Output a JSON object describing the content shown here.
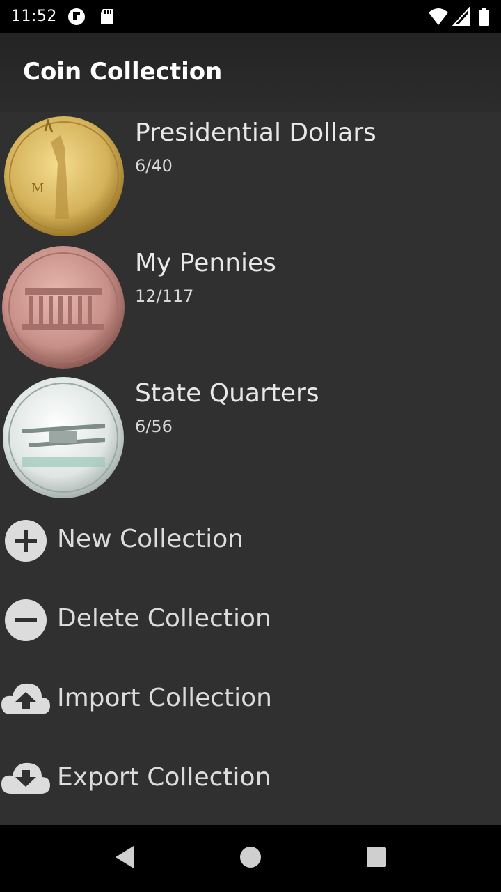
{
  "status_bar": {
    "time": "11:52",
    "icons": [
      "app-notification-icon",
      "sd-card-icon",
      "wifi-icon",
      "signal-icon",
      "battery-icon"
    ]
  },
  "app_bar": {
    "title": "Coin Collection"
  },
  "collections": [
    {
      "name": "Presidential Dollars",
      "count": "6/40",
      "coin": "gold-dollar-icon"
    },
    {
      "name": "My Pennies",
      "count": "12/117",
      "coin": "penny-icon"
    },
    {
      "name": "State Quarters",
      "count": "6/56",
      "coin": "quarter-icon"
    }
  ],
  "actions": [
    {
      "label": "New Collection",
      "icon": "plus-circle-icon"
    },
    {
      "label": "Delete Collection",
      "icon": "minus-circle-icon"
    },
    {
      "label": "Import Collection",
      "icon": "cloud-upload-icon"
    },
    {
      "label": "Export Collection",
      "icon": "cloud-download-icon"
    }
  ],
  "nav_bar": {
    "buttons": [
      "back-icon",
      "home-icon",
      "recents-icon"
    ]
  },
  "colors": {
    "background": "#303030",
    "status_bar": "#000000",
    "text_primary": "#e8e8e8",
    "gold": "#d4b25a",
    "copper": "#c89088",
    "silver": "#dfe6e3"
  }
}
